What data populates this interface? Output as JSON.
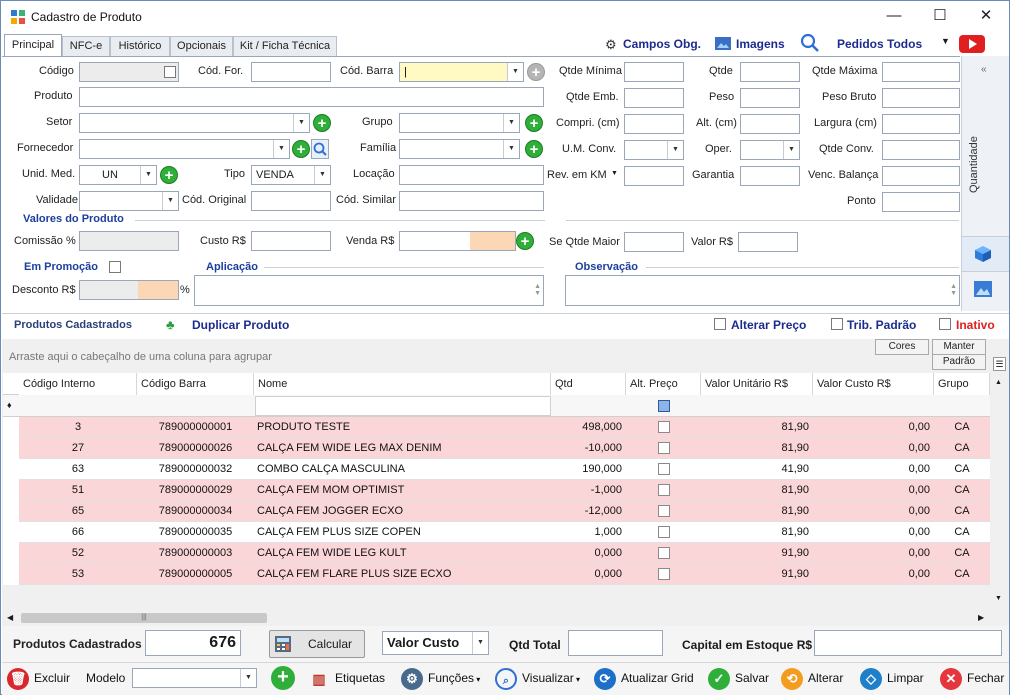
{
  "window": {
    "title": "Cadastro de Produto"
  },
  "tabs": [
    "Principal",
    "NFC-e",
    "Histórico",
    "Opcionais",
    "Kit / Ficha Técnica"
  ],
  "header_links": {
    "campos": "Campos Obg.",
    "imagens": "Imagens",
    "pedidos": "Pedidos Todos"
  },
  "form": {
    "codigo": "Código",
    "cod_for": "Cód. For.",
    "cod_barra": "Cód. Barra",
    "qtde_minima": "Qtde Mínima",
    "qtde": "Qtde",
    "qtde_maxima": "Qtde Máxima",
    "produto": "Produto",
    "qtde_emb": "Qtde Emb.",
    "peso": "Peso",
    "peso_bruto": "Peso Bruto",
    "setor": "Setor",
    "grupo": "Grupo",
    "compri": "Compri. (cm)",
    "alt": "Alt. (cm)",
    "largura": "Largura (cm)",
    "fornecedor": "Fornecedor",
    "familia": "Família",
    "um_conv": "U.M. Conv.",
    "oper": "Oper.",
    "qtde_conv": "Qtde Conv.",
    "unid_med": "Unid. Med.",
    "unid_med_value": "UN",
    "tipo": "Tipo",
    "tipo_value": "VENDA",
    "locacao": "Locação",
    "rev_km": "Rev. em KM",
    "garantia": "Garantia",
    "venc_balanca": "Venc. Balança",
    "validade": "Validade",
    "cod_original": "Cód. Original",
    "cod_similar": "Cód. Similar",
    "ponto": "Ponto",
    "valores_produto": "Valores do Produto",
    "comissao": "Comissão %",
    "custo": "Custo R$",
    "venda": "Venda R$",
    "se_qtde_maior": "Se Qtde Maior",
    "valor": "Valor R$",
    "em_promocao": "Em Promoção",
    "aplicacao": "Aplicação",
    "observacao": "Observação",
    "desconto": "Desconto R$",
    "percent": "%"
  },
  "right_panel": {
    "quantidade": "Quantidade"
  },
  "products_header": {
    "title": "Produtos Cadastrados",
    "duplicar": "Duplicar Produto",
    "alterar_preco": "Alterar Preço",
    "trib_padrao": "Trib. Padrão",
    "inativo": "Inativo",
    "cores": "Cores",
    "manter": "Manter",
    "padrao": "Padrão",
    "group_hint": "Arraste aqui o cabeçalho de uma coluna para agrupar"
  },
  "grid": {
    "columns": [
      "Código Interno",
      "Código Barra",
      "Nome",
      "Qtd",
      "Alt. Preço",
      "Valor Unitário R$",
      "Valor Custo R$",
      "Grupo"
    ],
    "rows": [
      {
        "cod": "3",
        "barra": "789000000001",
        "nome": "PRODUTO TESTE",
        "qtd": "498,000",
        "valor": "81,90",
        "custo": "0,00",
        "grupo": "CA",
        "hl": true
      },
      {
        "cod": "27",
        "barra": "789000000026",
        "nome": "CALÇA FEM WIDE LEG MAX DENIM",
        "qtd": "-10,000",
        "valor": "81,90",
        "custo": "0,00",
        "grupo": "CA",
        "hl": true
      },
      {
        "cod": "63",
        "barra": "789000000032",
        "nome": "COMBO CALÇA MASCULINA",
        "qtd": "190,000",
        "valor": "41,90",
        "custo": "0,00",
        "grupo": "CA",
        "hl": false
      },
      {
        "cod": "51",
        "barra": "789000000029",
        "nome": "CALÇA FEM MOM OPTIMIST",
        "qtd": "-1,000",
        "valor": "81,90",
        "custo": "0,00",
        "grupo": "CA",
        "hl": true
      },
      {
        "cod": "65",
        "barra": "789000000034",
        "nome": "CALÇA FEM JOGGER ECXO",
        "qtd": "-12,000",
        "valor": "81,90",
        "custo": "0,00",
        "grupo": "CA",
        "hl": true
      },
      {
        "cod": "66",
        "barra": "789000000035",
        "nome": "CALÇA FEM PLUS SIZE COPEN",
        "qtd": "1,000",
        "valor": "81,90",
        "custo": "0,00",
        "grupo": "CA",
        "hl": false
      },
      {
        "cod": "52",
        "barra": "789000000003",
        "nome": "CALÇA FEM WIDE LEG KULT",
        "qtd": "0,000",
        "valor": "91,90",
        "custo": "0,00",
        "grupo": "CA",
        "hl": true
      },
      {
        "cod": "53",
        "barra": "789000000005",
        "nome": "CALÇA FEM FLARE PLUS SIZE ECXO",
        "qtd": "0,000",
        "valor": "91,90",
        "custo": "0,00",
        "grupo": "CA",
        "hl": true
      }
    ]
  },
  "summary": {
    "produtos_cadastrados": "Produtos Cadastrados",
    "count": "676",
    "calcular": "Calcular",
    "valor_custo": "Valor Custo",
    "qtd_total": "Qtd Total",
    "capital": "Capital em Estoque R$"
  },
  "toolbar": {
    "excluir": "Excluir",
    "modelo": "Modelo",
    "etiquetas": "Etiquetas",
    "funcoes": "Funções",
    "visualizar": "Visualizar",
    "atualizar": "Atualizar Grid",
    "salvar": "Salvar",
    "alterar": "Alterar",
    "limpar": "Limpar",
    "fechar": "Fechar"
  },
  "colors": {
    "accent": "#1c3f9e",
    "row_highlight": "#fbd6d9",
    "add_green": "#2fae3a",
    "danger": "#e02020"
  }
}
